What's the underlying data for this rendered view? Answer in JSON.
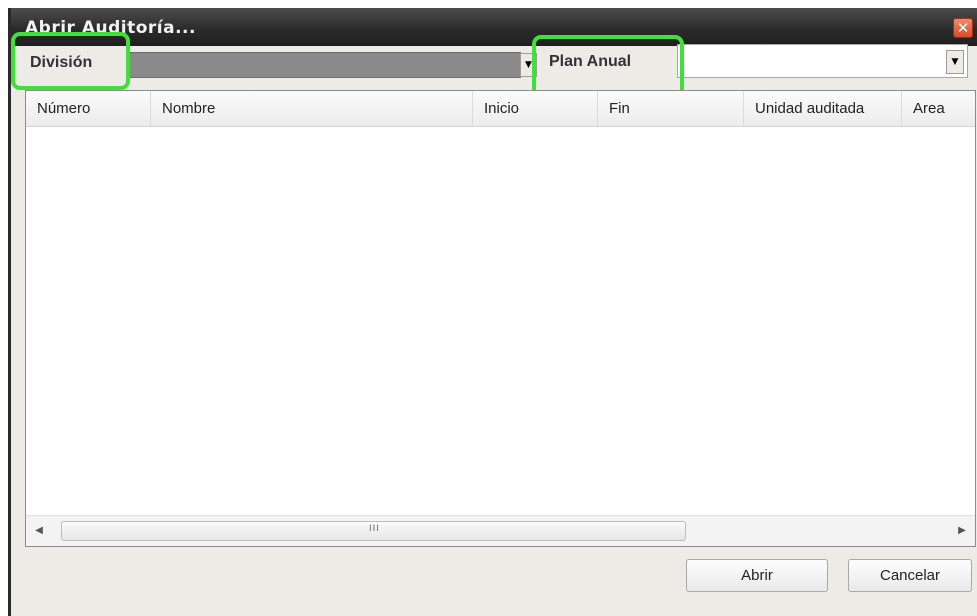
{
  "window": {
    "title": "Abrir Auditoría...",
    "close_glyph": "✕"
  },
  "filters": {
    "division_label": "División",
    "division_value": "",
    "plan_label": "Plan Anual",
    "plan_value": "",
    "dropdown_glyph": "▼"
  },
  "table": {
    "columns": [
      "Número",
      "Nombre",
      "Inicio",
      "Fin",
      "Unidad auditada",
      "Area"
    ],
    "rows": []
  },
  "scrollbar": {
    "left_glyph": "◀",
    "right_glyph": "▶",
    "grip": "III"
  },
  "buttons": {
    "open": "Abrir",
    "cancel": "Cancelar"
  },
  "colors": {
    "highlight": "#3fe03a",
    "titlebar": "#2b2b2b",
    "division_field": "#8a8a8a"
  }
}
